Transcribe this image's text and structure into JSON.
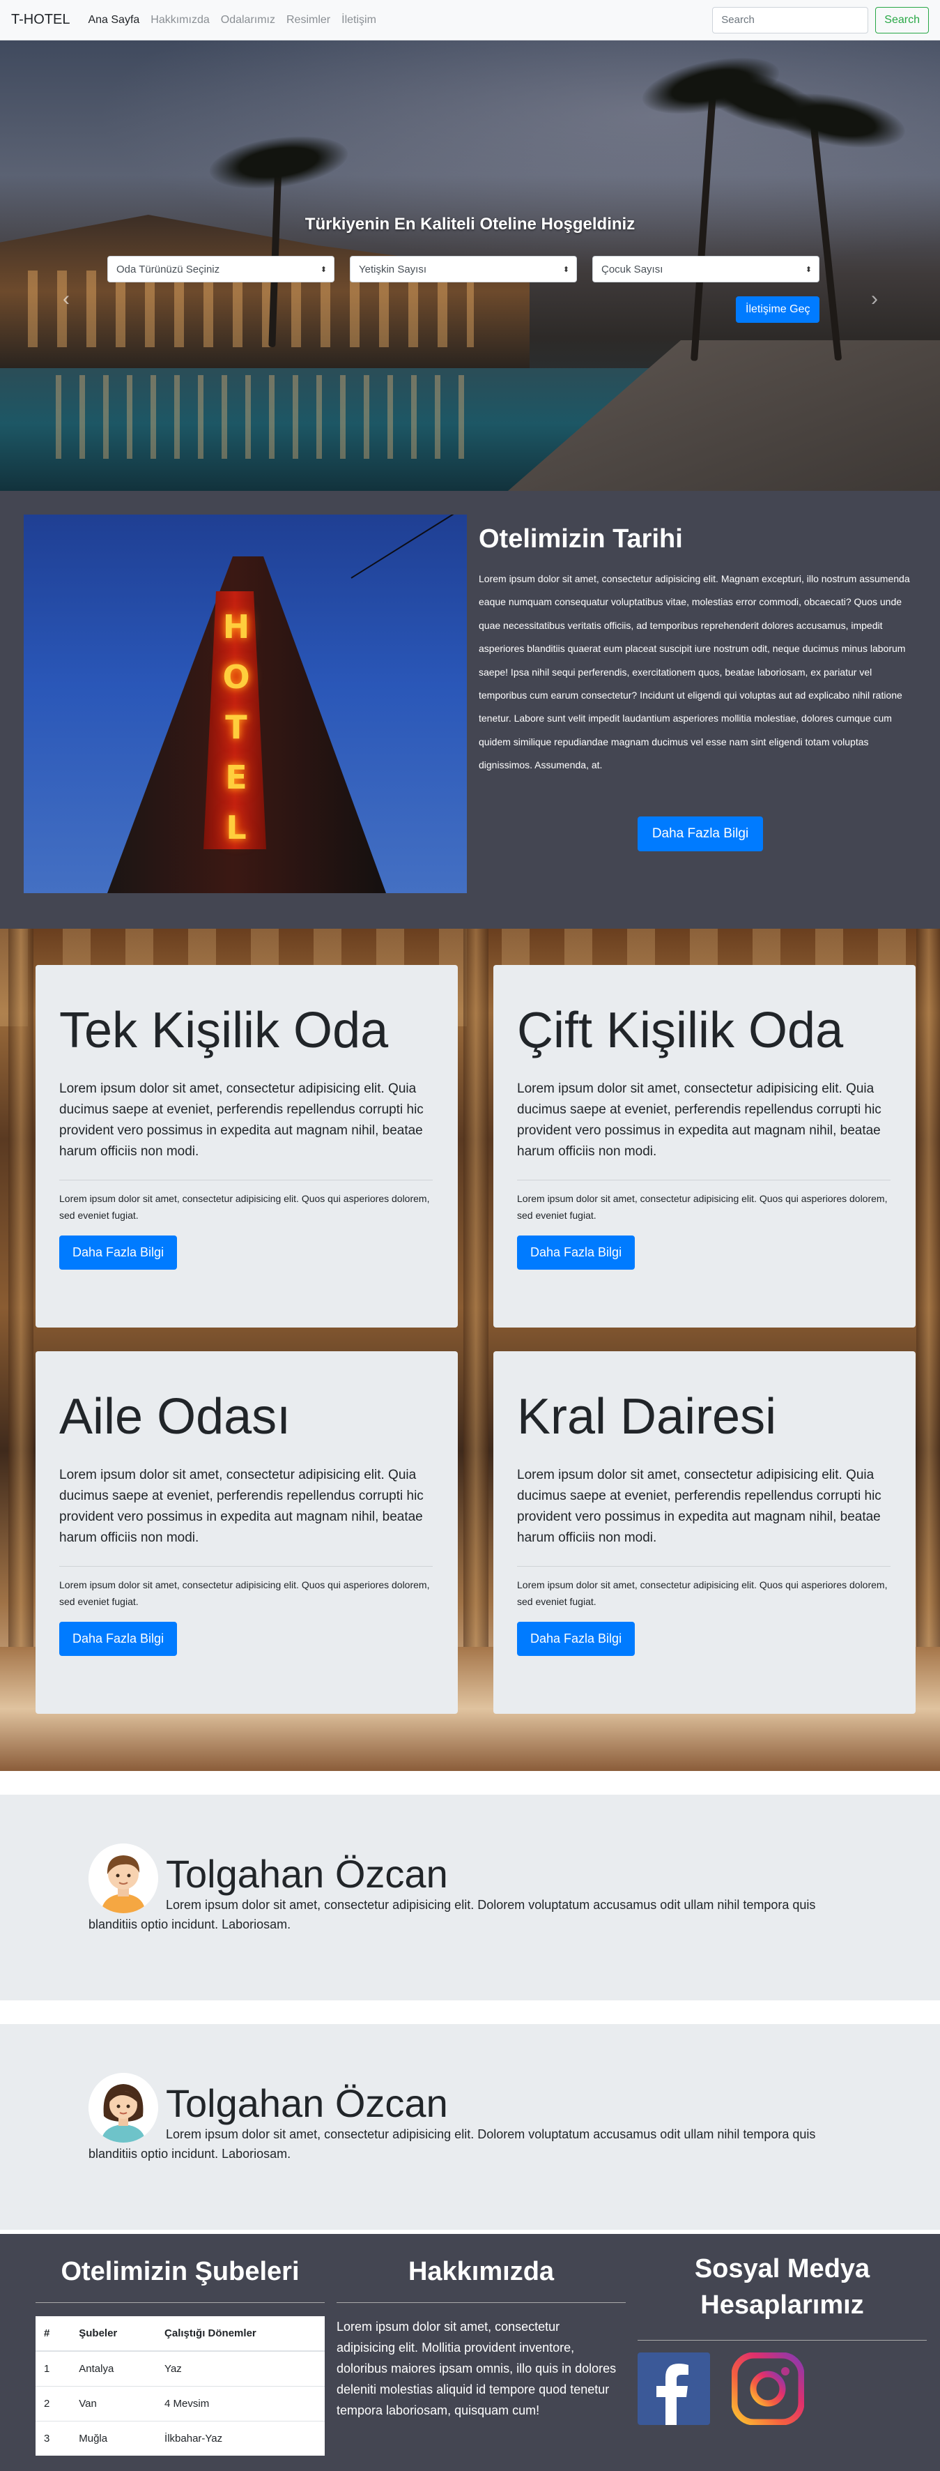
{
  "navbar": {
    "brand": "T-HOTEL",
    "links": [
      "Ana Sayfa",
      "Hakkımızda",
      "Odalarımız",
      "Resimler",
      "İletişim"
    ],
    "search_placeholder": "Search",
    "search_button": "Search"
  },
  "hero": {
    "title": "Türkiyenin En Kaliteli Oteline Hoşgeldiniz",
    "selects": [
      "Oda Türünüzü Seçiniz",
      "Yetişkin Sayısı",
      "Çocuk Sayısı"
    ],
    "button": "İletişime Geç",
    "prev": "‹",
    "next": "›"
  },
  "history": {
    "title": "Otelimizin Tarihi",
    "sign": "HOTEL",
    "text": "Lorem ipsum dolor sit amet, consectetur adipisicing elit. Magnam excepturi, illo nostrum assumenda eaque numquam consequatur voluptatibus vitae, molestias error commodi, obcaecati? Quos unde quae necessitatibus veritatis officiis, ad temporibus reprehenderit dolores accusamus, impedit asperiores blanditiis quaerat eum placeat suscipit iure nostrum odit, neque ducimus minus laborum saepe! Ipsa nihil sequi perferendis, exercitationem quos, beatae laboriosam, ex pariatur vel temporibus cum earum consectetur? Incidunt ut eligendi qui voluptas aut ad explicabo nihil ratione tenetur. Labore sunt velit impedit laudantium asperiores mollitia molestiae, dolores cumque cum quidem similique repudiandae magnam ducimus vel esse nam sint eligendi totam voluptas dignissimos. Assumenda, at.",
    "button": "Daha Fazla Bilgi"
  },
  "rooms": [
    {
      "title": "Tek Kişilik Oda",
      "lead": "Lorem ipsum dolor sit amet, consectetur adipisicing elit. Quia ducimus saepe at eveniet, perferendis repellendus corrupti hic provident vero possimus in expedita aut magnam nihil, beatae harum officiis non modi.",
      "small": "Lorem ipsum dolor sit amet, consectetur adipisicing elit. Quos qui asperiores dolorem, sed eveniet fugiat.",
      "button": "Daha Fazla Bilgi"
    },
    {
      "title": "Çift Kişilik Oda",
      "lead": "Lorem ipsum dolor sit amet, consectetur adipisicing elit. Quia ducimus saepe at eveniet, perferendis repellendus corrupti hic provident vero possimus in expedita aut magnam nihil, beatae harum officiis non modi.",
      "small": "Lorem ipsum dolor sit amet, consectetur adipisicing elit. Quos qui asperiores dolorem, sed eveniet fugiat.",
      "button": "Daha Fazla Bilgi"
    },
    {
      "title": "Aile Odası",
      "lead": "Lorem ipsum dolor sit amet, consectetur adipisicing elit. Quia ducimus saepe at eveniet, perferendis repellendus corrupti hic provident vero possimus in expedita aut magnam nihil, beatae harum officiis non modi.",
      "small": "Lorem ipsum dolor sit amet, consectetur adipisicing elit. Quos qui asperiores dolorem, sed eveniet fugiat.",
      "button": "Daha Fazla Bilgi"
    },
    {
      "title": "Kral Dairesi",
      "lead": "Lorem ipsum dolor sit amet, consectetur adipisicing elit. Quia ducimus saepe at eveniet, perferendis repellendus corrupti hic provident vero possimus in expedita aut magnam nihil, beatae harum officiis non modi.",
      "small": "Lorem ipsum dolor sit amet, consectetur adipisicing elit. Quos qui asperiores dolorem, sed eveniet fugiat.",
      "button": "Daha Fazla Bilgi"
    }
  ],
  "profiles": [
    {
      "name": "Tolgahan Özcan",
      "text": "Lorem ipsum dolor sit amet, consectetur adipisicing elit. Dolorem voluptatum accusamus odit ullam nihil tempora quis blanditiis optio incidunt. Laboriosam."
    },
    {
      "name": "Tolgahan Özcan",
      "text": "Lorem ipsum dolor sit amet, consectetur adipisicing elit. Dolorem voluptatum accusamus odit ullam nihil tempora quis blanditiis optio incidunt. Laboriosam."
    }
  ],
  "footer": {
    "branches_title": "Otelimizin Şubeleri",
    "table_headers": [
      "#",
      "Şubeler",
      "Çalıştığı Dönemler"
    ],
    "table_rows": [
      [
        "1",
        "Antalya",
        "Yaz"
      ],
      [
        "2",
        "Van",
        "4 Mevsim"
      ],
      [
        "3",
        "Muğla",
        "İlkbahar-Yaz"
      ]
    ],
    "about_title": "Hakkımızda",
    "about_text": "Lorem ipsum dolor sit amet, consectetur adipisicing elit. Mollitia provident inventore, doloribus maiores ipsam omnis, illo quis in dolores deleniti molestias aliquid id tempore quod tenetur tempora laboriosam, quisquam cum!",
    "social_title": "Sosyal Medya Hesaplarımız",
    "social_icons": [
      "facebook-icon",
      "instagram-icon"
    ]
  },
  "colors": {
    "primary": "#007bff",
    "success": "#28a745",
    "dark_section": "#444652",
    "card_bg": "#e9ecef"
  }
}
